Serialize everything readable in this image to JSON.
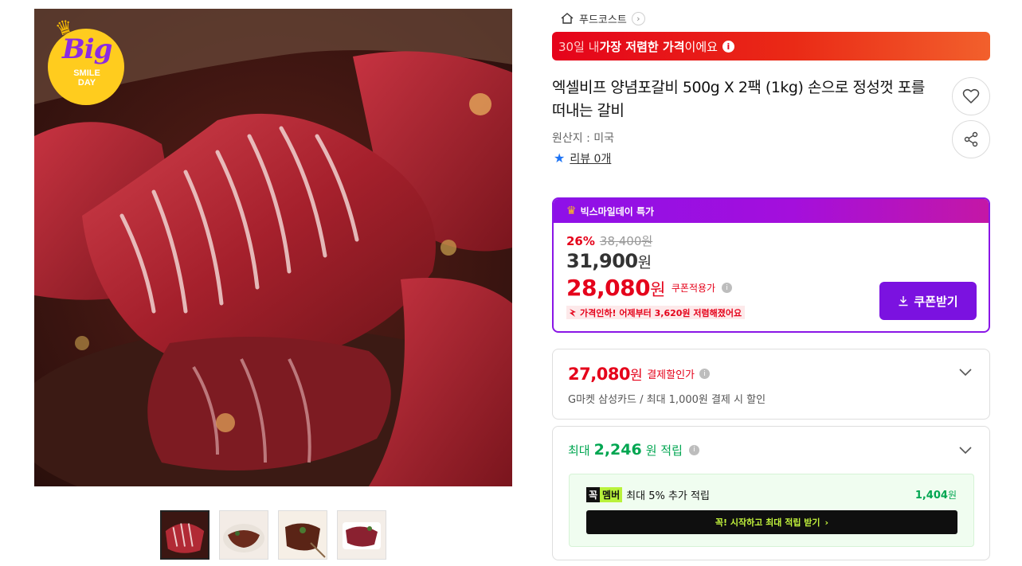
{
  "gallery": {
    "badge": {
      "big": "Big",
      "line1": "SMILE",
      "line2": "DAY"
    },
    "thumbnails": [
      "thumb-1",
      "thumb-2",
      "thumb-3",
      "thumb-4"
    ]
  },
  "store": {
    "name": "푸드코스트",
    "arrow": "›"
  },
  "lowest_banner": {
    "prefix": "30일 내 ",
    "highlight": "가장 저렴한 가격",
    "suffix": "이에요",
    "info": "i"
  },
  "product": {
    "title": "엑셀비프 양념포갈비 500g X 2팩 (1kg) 손으로 정성껏 포를 떠내는 갈비",
    "origin": "원산지 : 미국",
    "review_label": "리뷰 0개"
  },
  "special": {
    "header": "빅스마일데이 특가",
    "discount_rate": "26%",
    "original_price": "38,400원",
    "sale_price": "31,900",
    "sale_unit": "원",
    "coupon_price": "28,080",
    "coupon_unit": "원",
    "coupon_tag": "쿠폰적용가",
    "price_down": "가격인하! 어제부터 3,620원 저렴해졌어요",
    "coupon_button": "쿠폰받기"
  },
  "payment": {
    "price": "27,080",
    "unit": "원",
    "tag": "결제할인가",
    "desc": "G마켓 삼성카드 / 최대 1,000원 결제 시 할인"
  },
  "points": {
    "prefix": "최대",
    "amount": "2,246",
    "suffix": "원 적립",
    "member_logo_a": "꼭",
    "member_logo_b": "멤버",
    "member_text": "최대 5% 추가 적립",
    "member_points": "1,404",
    "member_unit": "원",
    "member_button": "꼭! 시작하고 최대 적립 받기",
    "member_button_arrow": "›"
  },
  "colors": {
    "accent_red": "#e5031b",
    "accent_purple": "#7b12e0",
    "accent_green": "#00a651",
    "badge_yellow": "#ffcc1e"
  }
}
